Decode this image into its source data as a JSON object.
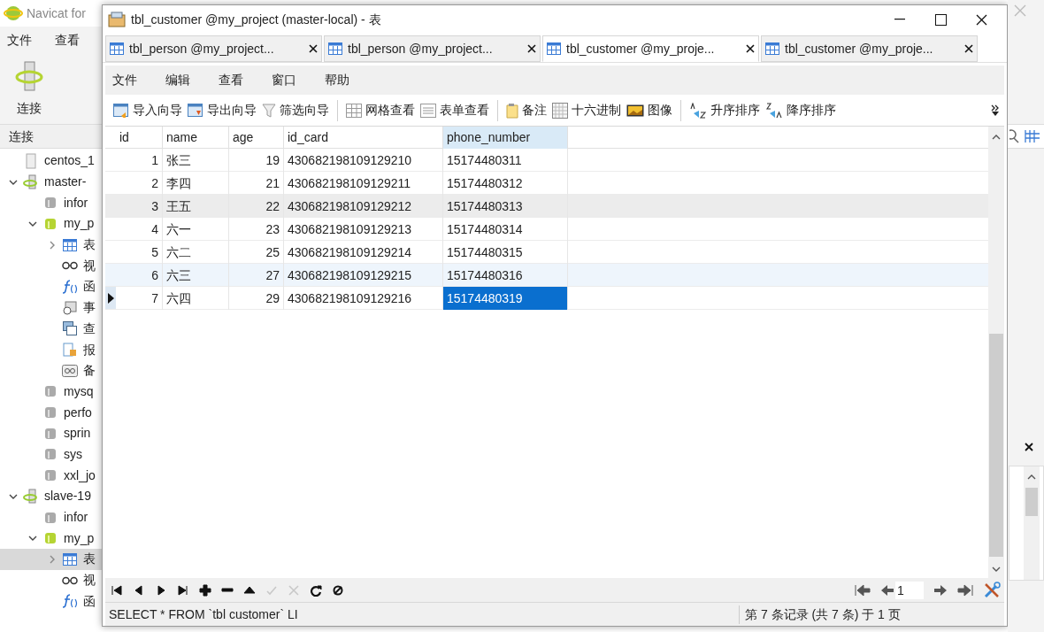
{
  "main_window": {
    "title": "Navicat for",
    "menu": [
      "文件",
      "查看"
    ],
    "toolbar_button": "连接",
    "pane_header": "连接",
    "tree": [
      {
        "label": "centos_1",
        "kind": "server"
      },
      {
        "label": "master-",
        "kind": "connection",
        "expanded": true,
        "children": [
          {
            "label": "infor",
            "kind": "database"
          },
          {
            "label": "my_p",
            "kind": "database-open",
            "expanded": true,
            "children": [
              {
                "label": "表",
                "kind": "tables",
                "expanded": false,
                "selected": false
              },
              {
                "label": "视",
                "kind": "views"
              },
              {
                "label": "函",
                "kind": "functions"
              },
              {
                "label": "事",
                "kind": "events"
              },
              {
                "label": "查",
                "kind": "queries"
              },
              {
                "label": "报",
                "kind": "reports"
              },
              {
                "label": "备",
                "kind": "backups"
              }
            ]
          },
          {
            "label": "mysq",
            "kind": "database"
          },
          {
            "label": "perfo",
            "kind": "database"
          },
          {
            "label": "sprin",
            "kind": "database"
          },
          {
            "label": "sys",
            "kind": "database"
          },
          {
            "label": "xxl_jo",
            "kind": "database"
          }
        ]
      },
      {
        "label": "slave-19",
        "kind": "connection",
        "expanded": true,
        "children": [
          {
            "label": "infor",
            "kind": "database"
          },
          {
            "label": "my_p",
            "kind": "database-open",
            "expanded": true,
            "children": [
              {
                "label": "表",
                "kind": "tables",
                "expanded": false,
                "selected": true
              },
              {
                "label": "视",
                "kind": "views"
              },
              {
                "label": "函",
                "kind": "functions"
              }
            ]
          }
        ]
      }
    ]
  },
  "window": {
    "title": "tbl_customer @my_project (master-local) - 表",
    "tabs": [
      {
        "label": "tbl_person @my_project...",
        "selected": false
      },
      {
        "label": "tbl_person @my_project...",
        "selected": false
      },
      {
        "label": "tbl_customer @my_proje...",
        "selected": true
      },
      {
        "label": "tbl_customer @my_proje...",
        "selected": false
      }
    ],
    "menu": [
      "文件",
      "编辑",
      "查看",
      "窗口",
      "帮助"
    ],
    "toolbar": [
      [
        {
          "label": "导入向导",
          "kind": "import"
        },
        {
          "label": "导出向导",
          "kind": "export"
        },
        {
          "label": "筛选向导",
          "kind": "filter"
        }
      ],
      [
        {
          "label": "网格查看",
          "kind": "grid"
        },
        {
          "label": "表单查看",
          "kind": "form"
        }
      ],
      [
        {
          "label": "备注",
          "kind": "memo"
        },
        {
          "label": "十六进制",
          "kind": "hex"
        },
        {
          "label": "图像",
          "kind": "image"
        }
      ],
      [
        {
          "label": "升序排序",
          "kind": "sort-asc"
        },
        {
          "label": "降序排序",
          "kind": "sort-desc"
        }
      ]
    ],
    "table": {
      "columns": [
        {
          "label": "id",
          "selected": false
        },
        {
          "label": "name",
          "selected": false
        },
        {
          "label": "age",
          "selected": false
        },
        {
          "label": "id_card",
          "selected": false
        },
        {
          "label": "phone_number",
          "selected": true
        }
      ],
      "rows": [
        {
          "cells": [
            "1",
            "张三",
            "19",
            "430682198109129210",
            "15174480311"
          ],
          "selected": false,
          "hovered": false,
          "tinted": false
        },
        {
          "cells": [
            "2",
            "李四",
            "21",
            "430682198109129211",
            "15174480312"
          ],
          "selected": false,
          "hovered": false,
          "tinted": false
        },
        {
          "cells": [
            "3",
            "王五",
            "22",
            "430682198109129212",
            "15174480313"
          ],
          "selected": false,
          "hovered": true,
          "tinted": false
        },
        {
          "cells": [
            "4",
            "六一",
            "23",
            "430682198109129213",
            "15174480314"
          ],
          "selected": false,
          "hovered": false,
          "tinted": false
        },
        {
          "cells": [
            "5",
            "六二",
            "25",
            "430682198109129214",
            "15174480315"
          ],
          "selected": false,
          "hovered": false,
          "tinted": false
        },
        {
          "cells": [
            "6",
            "六三",
            "27",
            "430682198109129215",
            "15174480316"
          ],
          "selected": false,
          "hovered": false,
          "tinted": true
        },
        {
          "cells": [
            "7",
            "六四",
            "29",
            "430682198109129216",
            "15174480319"
          ],
          "selected": true,
          "hovered": false,
          "tinted": false
        }
      ]
    },
    "record_buttons": [
      {
        "kind": "first",
        "disabled": false
      },
      {
        "kind": "prev",
        "disabled": false
      },
      {
        "kind": "next",
        "disabled": false
      },
      {
        "kind": "last",
        "disabled": false
      },
      {
        "kind": "add",
        "disabled": false
      },
      {
        "kind": "delete",
        "disabled": false
      },
      {
        "kind": "up",
        "disabled": false
      },
      {
        "kind": "apply",
        "disabled": true
      },
      {
        "kind": "discard",
        "disabled": true
      },
      {
        "kind": "refresh",
        "disabled": false
      },
      {
        "kind": "stop",
        "disabled": false
      }
    ],
    "page": "1",
    "sql": "SELECT * FROM `tbl customer` LI",
    "status": "第 7 条记录 (共 7 条) 于 1 页"
  }
}
